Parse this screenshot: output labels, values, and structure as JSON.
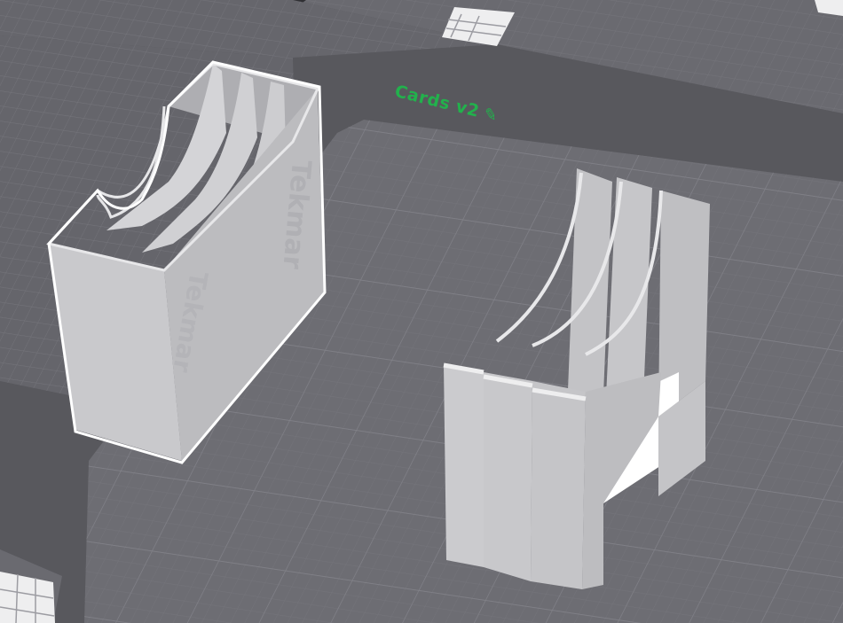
{
  "plate": {
    "name": "Cards v2",
    "edit_icon": "pencil-icon"
  },
  "colors": {
    "background": "#58585d",
    "build_plate": "#6c6c72",
    "grid_line": "#7b7b82",
    "model": "#c8c8ca",
    "selection_outline": "#ffffff",
    "label": "#22b14c"
  },
  "objects": [
    {
      "id": "card-box-selected",
      "selected": true,
      "embossed_text": "Tekmar"
    },
    {
      "id": "card-holder-three-slot",
      "selected": false
    }
  ]
}
